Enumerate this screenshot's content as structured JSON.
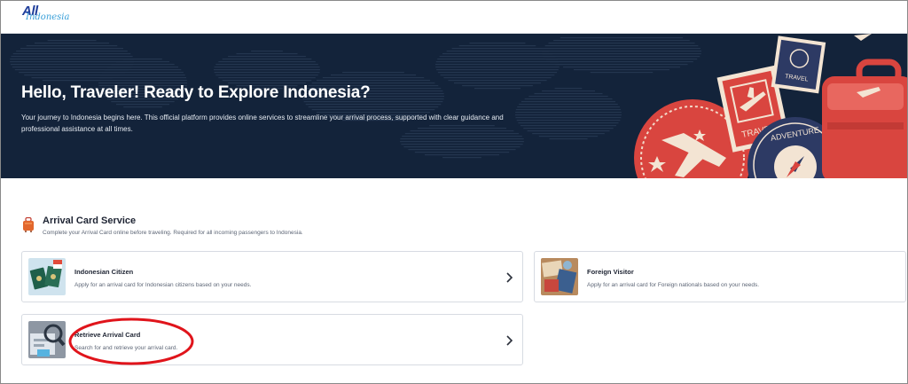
{
  "header": {
    "logo_main": "All",
    "logo_sub": "Indonesia"
  },
  "hero": {
    "title": "Hello, Traveler! Ready to Explore Indonesia?",
    "description": "Your journey to Indonesia begins here. This official platform provides online services to streamline your arrival process, supported with clear guidance and professional assistance at all times.",
    "stamps": {
      "travel_small": "TRAVEL",
      "travel_stamp": "TRAVEL",
      "adventure": "ADVENTURE"
    }
  },
  "section": {
    "icon": "luggage-icon",
    "title": "Arrival Card Service",
    "subtitle": "Complete your Arrival Card online before traveling. Required for all incoming passengers to Indonesia."
  },
  "cards": {
    "citizen": {
      "title": "Indonesian Citizen",
      "description": "Apply for an arrival card for Indonesian citizens based on your needs.",
      "icon": "chevron-right-icon"
    },
    "foreign": {
      "title": "Foreign Visitor",
      "description": "Apply for an arrival card for Foreign nationals based on your needs.",
      "icon": "chevron-right-icon"
    },
    "retrieve": {
      "title": "Retrieve Arrival Card",
      "description": "Search for and retrieve your arrival card.",
      "icon": "chevron-right-icon"
    }
  },
  "colors": {
    "hero_bg": "#13233a",
    "stamp_red": "#d9453f",
    "stamp_navy": "#2d3a64",
    "highlight_ellipse": "#e0141b"
  }
}
